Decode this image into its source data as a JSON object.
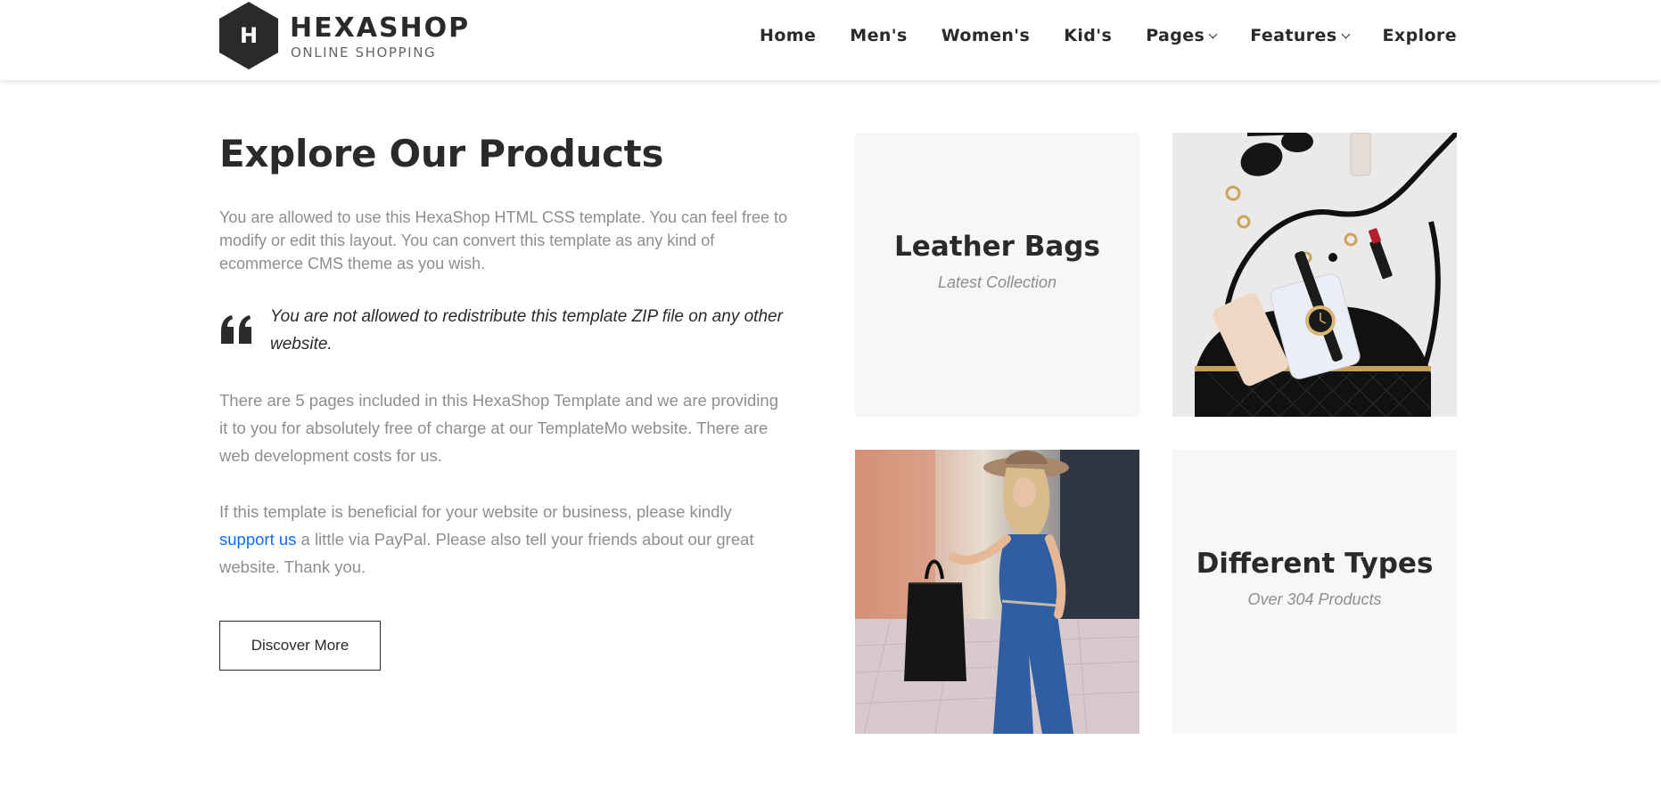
{
  "header": {
    "logo": {
      "letter": "H",
      "name": "HEXASHOP",
      "tagline": "ONLINE SHOPPING"
    },
    "nav": [
      {
        "label": "Home",
        "dropdown": false
      },
      {
        "label": "Men's",
        "dropdown": false
      },
      {
        "label": "Women's",
        "dropdown": false
      },
      {
        "label": "Kid's",
        "dropdown": false
      },
      {
        "label": "Pages",
        "dropdown": true
      },
      {
        "label": "Features",
        "dropdown": true
      },
      {
        "label": "Explore",
        "dropdown": false
      }
    ]
  },
  "explore": {
    "title": "Explore Our Products",
    "paragraph1": "You are allowed to use this HexaShop HTML CSS template. You can feel free to modify or edit this layout. You can convert this template as any kind of ecommerce CMS theme as you wish.",
    "quote": "You are not allowed to redistribute this template ZIP file on any other website.",
    "paragraph2": "There are 5 pages included in this HexaShop Template and we are providing it to you for absolutely free of charge at our TemplateMo website. There are web development costs for us.",
    "paragraph3_before": "If this template is beneficial for your website or business, please kindly ",
    "paragraph3_link": "support us",
    "paragraph3_after": " a little via PayPal. Please also tell your friends about our great website. Thank you.",
    "button_label": "Discover More"
  },
  "tiles": {
    "leather": {
      "title": "Leather Bags",
      "subtitle": "Latest Collection"
    },
    "types": {
      "title": "Different Types",
      "subtitle": "Over 304 Products"
    }
  },
  "colors": {
    "text_dark": "#2a2a2a",
    "text_muted": "#8e8e8e",
    "link": "#0d6efd",
    "tile_bg": "#f7f7f7",
    "logo_hex": "#2a2a2a"
  }
}
